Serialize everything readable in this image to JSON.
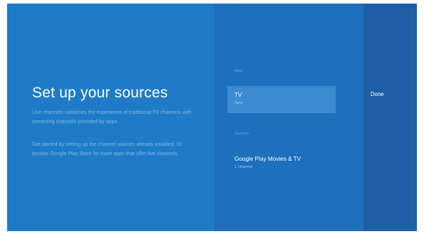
{
  "setup": {
    "title": "Set up your sources",
    "description_1": "Live channels combines the experience of traditional TV channels with streaming channels provided by apps.",
    "description_2": "Get started by setting up the channel sources already installed. Or browse Google Play Store for more apps that offer live channels."
  },
  "sources_list": {
    "new_header": "New",
    "new_items": [
      {
        "title": "TV",
        "subtitle": "New"
      }
    ],
    "sources_header": "Sources",
    "source_items": [
      {
        "title": "Google Play Movies & TV",
        "subtitle": "1 channel"
      }
    ]
  },
  "actions": {
    "done_label": "Done"
  },
  "colors": {
    "left_panel": "#1f7bc8",
    "middle_panel": "#1e6fbc",
    "right_panel": "#1f5fa6",
    "selected_item": "#3d8bd0",
    "header_text": "#6cb1ea"
  }
}
